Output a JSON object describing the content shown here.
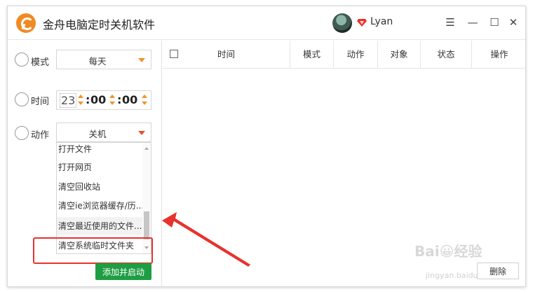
{
  "app": {
    "title": "金舟电脑定时关机软件"
  },
  "user": {
    "name": "Lyan"
  },
  "window_controls": {
    "menu": "☰",
    "minimize": "—",
    "maximize": "☐",
    "close": "✕"
  },
  "form": {
    "mode": {
      "label": "模式",
      "value": "每天"
    },
    "time": {
      "label": "时间",
      "hour": "23",
      "minute": "00",
      "second": "00",
      "separator": ":"
    },
    "action": {
      "label": "动作",
      "value": "关机",
      "options": [
        "打开文件",
        "打开网页",
        "清空回收站",
        "清空ie浏览器缓存/历...",
        "清空最近使用的文件...",
        "清空系统临时文件夹"
      ],
      "highlighted_index": 4
    },
    "add_button": "添加并启动"
  },
  "table": {
    "columns": [
      "时间",
      "模式",
      "动作",
      "对象",
      "状态",
      "操作"
    ],
    "rows": []
  },
  "delete_button": "删除",
  "watermark": {
    "text": "Bai😀经验",
    "sub": "jingyan.baidu.com"
  },
  "colors": {
    "accent_orange": "#f0922b",
    "primary_green": "#1e9e43",
    "annotation_red": "#e8322d"
  }
}
